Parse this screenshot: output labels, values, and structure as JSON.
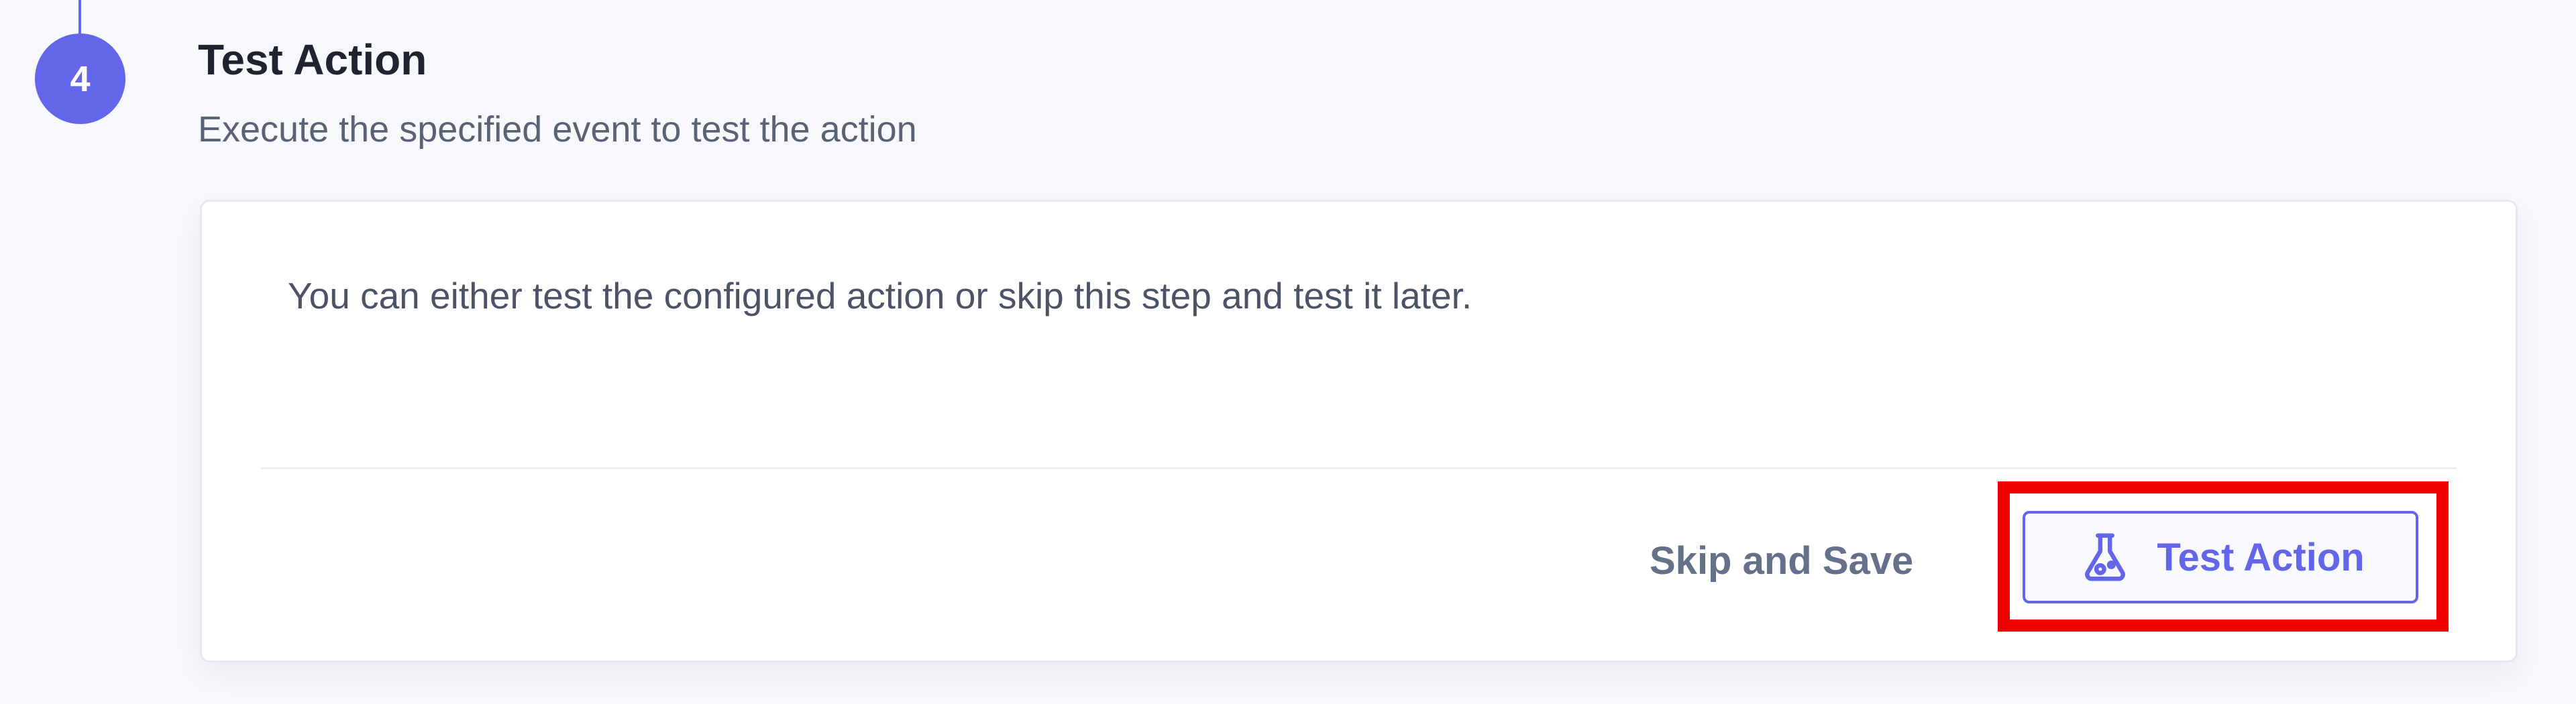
{
  "step": {
    "number": "4",
    "title": "Test Action",
    "subtitle": "Execute the specified event to test the action"
  },
  "card": {
    "message": "You can either test the configured action or skip this step and test it later.",
    "skip_label": "Skip and Save",
    "test_label": "Test Action"
  },
  "icons": {
    "test_button_icon": "flask-icon"
  },
  "colors": {
    "accent": "#6366e8",
    "highlight": "#ee0000"
  }
}
